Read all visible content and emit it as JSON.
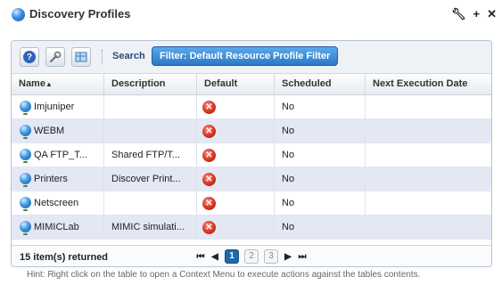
{
  "window": {
    "title": "Discovery Profiles",
    "icons": [
      "wrench-icon",
      "plus-icon",
      "close-icon"
    ]
  },
  "toolbar": {
    "help_icon": "?",
    "search_label": "Search",
    "filter_label": "Filter: Default Resource Profile Filter"
  },
  "table": {
    "columns": [
      "Name",
      "Description",
      "Default",
      "Scheduled",
      "Next Execution Date"
    ],
    "sort_indicator": "▲",
    "rows": [
      {
        "name": "Imjuniper",
        "description": "",
        "default": "✕",
        "scheduled": "No",
        "next": ""
      },
      {
        "name": "WEBM",
        "description": "",
        "default": "✕",
        "scheduled": "No",
        "next": ""
      },
      {
        "name": "QA FTP_T...",
        "description": "Shared FTP/T...",
        "default": "✕",
        "scheduled": "No",
        "next": ""
      },
      {
        "name": "Printers",
        "description": "Discover Print...",
        "default": "✕",
        "scheduled": "No",
        "next": ""
      },
      {
        "name": "Netscreen",
        "description": "",
        "default": "✕",
        "scheduled": "No",
        "next": ""
      },
      {
        "name": "MIMICLab",
        "description": "MIMIC simulati...",
        "default": "✕",
        "scheduled": "No",
        "next": ""
      }
    ]
  },
  "footer": {
    "count_text": "15 item(s) returned",
    "pages": [
      "1",
      "2",
      "3"
    ],
    "current_page": "1"
  },
  "hint": "Hint: Right click on the table to open a Context Menu to execute actions against the tables contents."
}
